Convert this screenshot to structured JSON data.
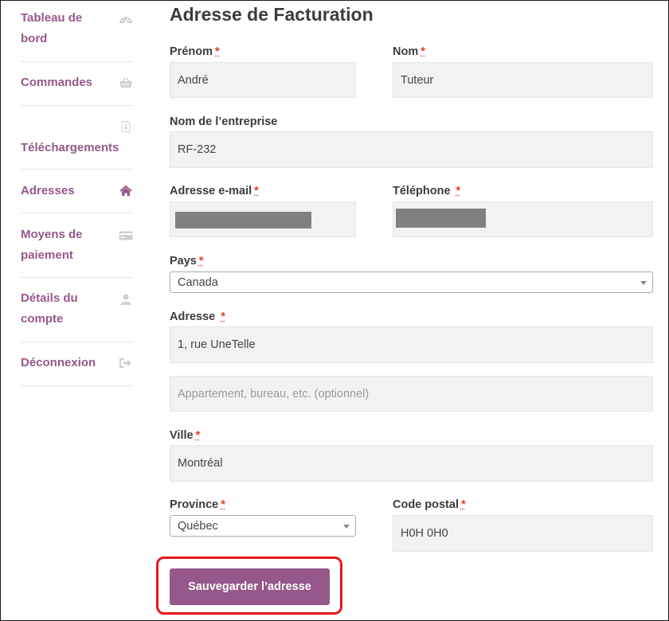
{
  "sidebar": {
    "items": [
      {
        "label": "Tableau de bord",
        "icon": "dashboard-icon"
      },
      {
        "label": "Commandes",
        "icon": "basket-icon"
      },
      {
        "label": "Téléchargements",
        "icon": "file-download-icon"
      },
      {
        "label": "Adresses",
        "icon": "home-icon",
        "active": true
      },
      {
        "label": "Moyens de paiement",
        "icon": "credit-card-icon"
      },
      {
        "label": "Détails du compte",
        "icon": "user-icon"
      },
      {
        "label": "Déconnexion",
        "icon": "sign-out-icon"
      }
    ]
  },
  "form": {
    "title": "Adresse de Facturation",
    "required_mark": "*",
    "first_name": {
      "label": "Prénom",
      "value": "André"
    },
    "last_name": {
      "label": "Nom",
      "value": "Tuteur"
    },
    "company": {
      "label": "Nom de l’entreprise",
      "value": "RF-232"
    },
    "email": {
      "label": "Adresse e-mail",
      "value": ""
    },
    "phone": {
      "label": "Téléphone",
      "value": ""
    },
    "country": {
      "label": "Pays",
      "value": "Canada"
    },
    "address": {
      "label": "Adresse",
      "value": "1, rue UneTelle"
    },
    "address2": {
      "placeholder": "Appartement, bureau, etc. (optionnel)",
      "value": ""
    },
    "city": {
      "label": "Ville",
      "value": "Montréal"
    },
    "province": {
      "label": "Province",
      "value": "Québec"
    },
    "postal": {
      "label": "Code postal",
      "value": "H0H 0H0"
    },
    "save_label": "Sauvegarder l’adresse"
  },
  "colors": {
    "accent": "#96588a",
    "required": "#e2401c",
    "highlight": "#e8161b"
  }
}
